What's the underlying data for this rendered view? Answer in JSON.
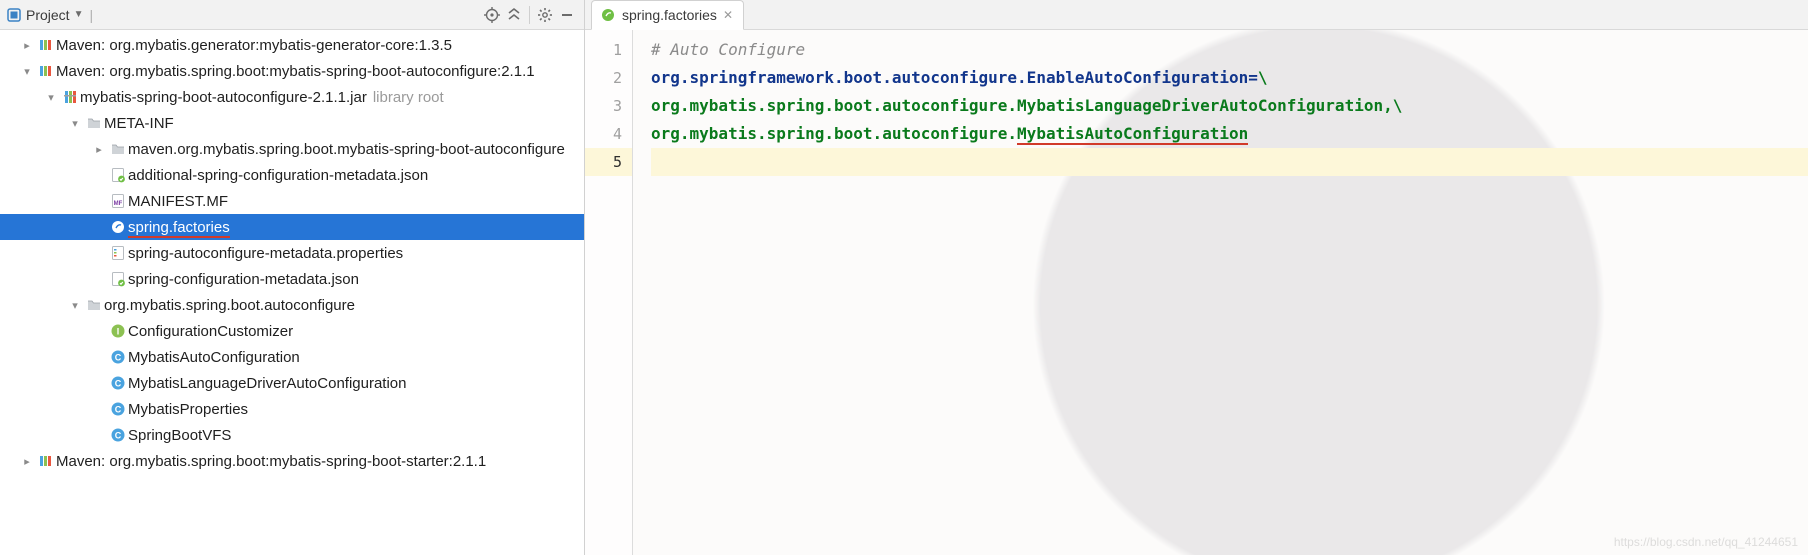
{
  "panel": {
    "title": "Project",
    "icons": {
      "target": "crosshair-icon",
      "collapse": "collapse-icon",
      "gear": "gear-icon",
      "hide": "minimize-icon"
    }
  },
  "tree": [
    {
      "depth": 0,
      "arrow": "right",
      "icon": "lib",
      "label": "Maven: org.mybatis.generator:mybatis-generator-core:1.3.5"
    },
    {
      "depth": 0,
      "arrow": "down",
      "icon": "lib",
      "label": "Maven: org.mybatis.spring.boot:mybatis-spring-boot-autoconfigure:2.1.1"
    },
    {
      "depth": 1,
      "arrow": "down",
      "icon": "jar",
      "label": "mybatis-spring-boot-autoconfigure-2.1.1.jar",
      "suffix": "library root"
    },
    {
      "depth": 2,
      "arrow": "down",
      "icon": "folder",
      "label": "META-INF"
    },
    {
      "depth": 3,
      "arrow": "right",
      "icon": "folder",
      "label": "maven.org.mybatis.spring.boot.mybatis-spring-boot-autoconfigure"
    },
    {
      "depth": 3,
      "arrow": "",
      "icon": "json",
      "label": "additional-spring-configuration-metadata.json"
    },
    {
      "depth": 3,
      "arrow": "",
      "icon": "mf",
      "label": "MANIFEST.MF"
    },
    {
      "depth": 3,
      "arrow": "",
      "icon": "spring",
      "label": "spring.factories",
      "selected": true
    },
    {
      "depth": 3,
      "arrow": "",
      "icon": "props",
      "label": "spring-autoconfigure-metadata.properties"
    },
    {
      "depth": 3,
      "arrow": "",
      "icon": "json",
      "label": "spring-configuration-metadata.json"
    },
    {
      "depth": 2,
      "arrow": "down",
      "icon": "folder",
      "label": "org.mybatis.spring.boot.autoconfigure"
    },
    {
      "depth": 3,
      "arrow": "",
      "icon": "iface",
      "label": "ConfigurationCustomizer"
    },
    {
      "depth": 3,
      "arrow": "",
      "icon": "class",
      "label": "MybatisAutoConfiguration"
    },
    {
      "depth": 3,
      "arrow": "",
      "icon": "class",
      "label": "MybatisLanguageDriverAutoConfiguration"
    },
    {
      "depth": 3,
      "arrow": "",
      "icon": "class",
      "label": "MybatisProperties"
    },
    {
      "depth": 3,
      "arrow": "",
      "icon": "class",
      "label": "SpringBootVFS"
    },
    {
      "depth": 0,
      "arrow": "right",
      "icon": "lib",
      "label": "Maven: org.mybatis.spring.boot:mybatis-spring-boot-starter:2.1.1"
    }
  ],
  "editor": {
    "tab": {
      "title": "spring.factories"
    },
    "lines": [
      {
        "n": "1",
        "type": "comment",
        "text": "# Auto Configure"
      },
      {
        "n": "2",
        "type": "kv",
        "key": "org.springframework.boot.autoconfigure.EnableAutoConfiguration",
        "eq": "=",
        "val": "\\"
      },
      {
        "n": "3",
        "type": "val",
        "val": "org.mybatis.spring.boot.autoconfigure.MybatisLanguageDriverAutoConfiguration,\\"
      },
      {
        "n": "4",
        "type": "val-split",
        "prefix": "org.mybatis.spring.boot.autoconfigure.",
        "highlight": "MybatisAutoConfiguration"
      },
      {
        "n": "5",
        "type": "empty",
        "current": true
      }
    ]
  },
  "watermark": "https://blog.csdn.net/qq_41244651"
}
